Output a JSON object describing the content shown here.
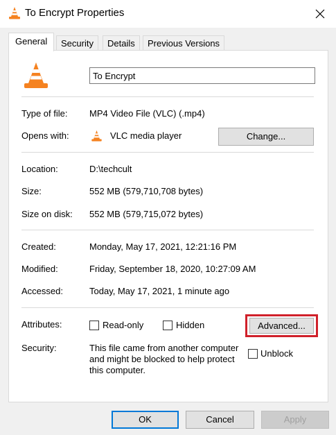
{
  "window": {
    "title": "To Encrypt Properties"
  },
  "tabs": [
    "General",
    "Security",
    "Details",
    "Previous Versions"
  ],
  "file": {
    "name": "To Encrypt",
    "type_label": "Type of file:",
    "type_value": "MP4 Video File (VLC) (.mp4)",
    "opens_label": "Opens with:",
    "opens_value": "VLC media player",
    "change_button": "Change...",
    "location_label": "Location:",
    "location_value": "D:\\techcult",
    "size_label": "Size:",
    "size_value": "552 MB (579,710,708 bytes)",
    "size_on_disk_label": "Size on disk:",
    "size_on_disk_value": "552 MB (579,715,072 bytes)",
    "created_label": "Created:",
    "created_value": "Monday, May 17, 2021, 12:21:16 PM",
    "modified_label": "Modified:",
    "modified_value": "Friday, September 18, 2020, 10:27:09 AM",
    "accessed_label": "Accessed:",
    "accessed_value": "Today, May 17, 2021, 1 minute ago",
    "attributes_label": "Attributes:",
    "readonly_label": "Read-only",
    "hidden_label": "Hidden",
    "advanced_button": "Advanced...",
    "security_label": "Security:",
    "security_text": "This file came from another computer and might be blocked to help protect this computer.",
    "unblock_label": "Unblock"
  },
  "footer": {
    "ok": "OK",
    "cancel": "Cancel",
    "apply": "Apply"
  },
  "colors": {
    "highlight": "#d0202a",
    "vlc_orange": "#f58220",
    "default_button_border": "#0078d7"
  },
  "icons": {
    "app_icon": "vlc-cone-icon",
    "close": "close-icon"
  }
}
